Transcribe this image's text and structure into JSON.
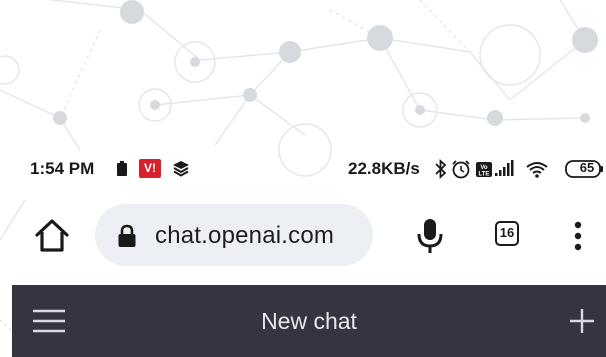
{
  "status_bar": {
    "time": "1:54 PM",
    "carrier_badge": "V!",
    "network_speed": "22.8KB/s",
    "battery_level": "65",
    "icons": [
      "battery-saver-icon",
      "vi-carrier-icon",
      "layers-icon",
      "bluetooth-icon",
      "alarm-icon",
      "volte-icon",
      "signal-icon",
      "wifi-icon",
      "battery-icon"
    ]
  },
  "browser": {
    "url": "chat.openai.com",
    "tab_count": "16",
    "icons": [
      "home-icon",
      "lock-icon",
      "microphone-icon",
      "tabs-icon",
      "more-vert-icon"
    ]
  },
  "chat_header": {
    "title": "New chat",
    "icons": [
      "hamburger-menu-icon",
      "plus-icon"
    ],
    "background": "#343541"
  },
  "colors": {
    "url_pill": "#eceff4",
    "carrier_red": "#d9212b",
    "header_text": "#e7e7ea"
  }
}
